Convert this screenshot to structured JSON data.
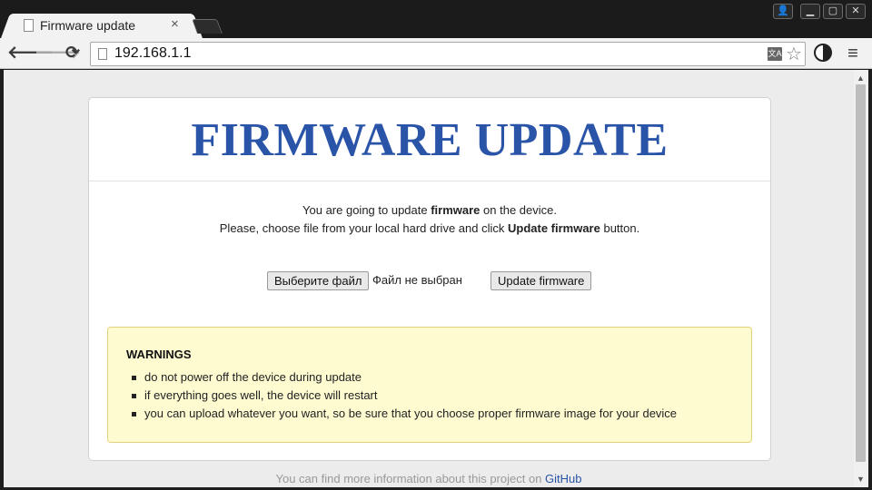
{
  "browser": {
    "tab_title": "Firmware update",
    "tab_close": "×",
    "url": "192.168.1.1",
    "window_buttons": {
      "user": "👤",
      "minimize": "▁",
      "maximize": "▢",
      "close": "✕"
    },
    "icons": {
      "back": "back-arrow-icon",
      "forward": "forward-arrow-icon",
      "reload": "reload-icon",
      "translate": "translate-icon",
      "bookmark": "star-icon",
      "extension": "contrast-icon",
      "menu": "hamburger-menu-icon"
    },
    "translate_glyph": "文A",
    "menu_glyph": "≡"
  },
  "page": {
    "title": "FIRMWARE UPDATE",
    "intro_line1_pre": "You are going to update ",
    "intro_line1_bold": "firmware",
    "intro_line1_post": " on the device.",
    "intro_line2_pre": "Please, choose file from your local hard drive and click ",
    "intro_line2_bold": "Update firmware",
    "intro_line2_post": " button.",
    "file_button": "Выберите файл",
    "file_status": "Файл не выбран",
    "submit_button": "Update firmware",
    "warnings": {
      "title": "WARNINGS",
      "items": [
        "do not power off the device during update",
        "if everything goes well, the device will restart",
        "you can upload whatever you want, so be sure that you choose proper firmware image for your device"
      ]
    },
    "footer_text": "You can find more information about this project on ",
    "footer_link": "GitHub"
  },
  "colors": {
    "title_blue": "#2a54a8",
    "warning_bg": "#fefbd1",
    "warning_border": "#e2d27c"
  }
}
